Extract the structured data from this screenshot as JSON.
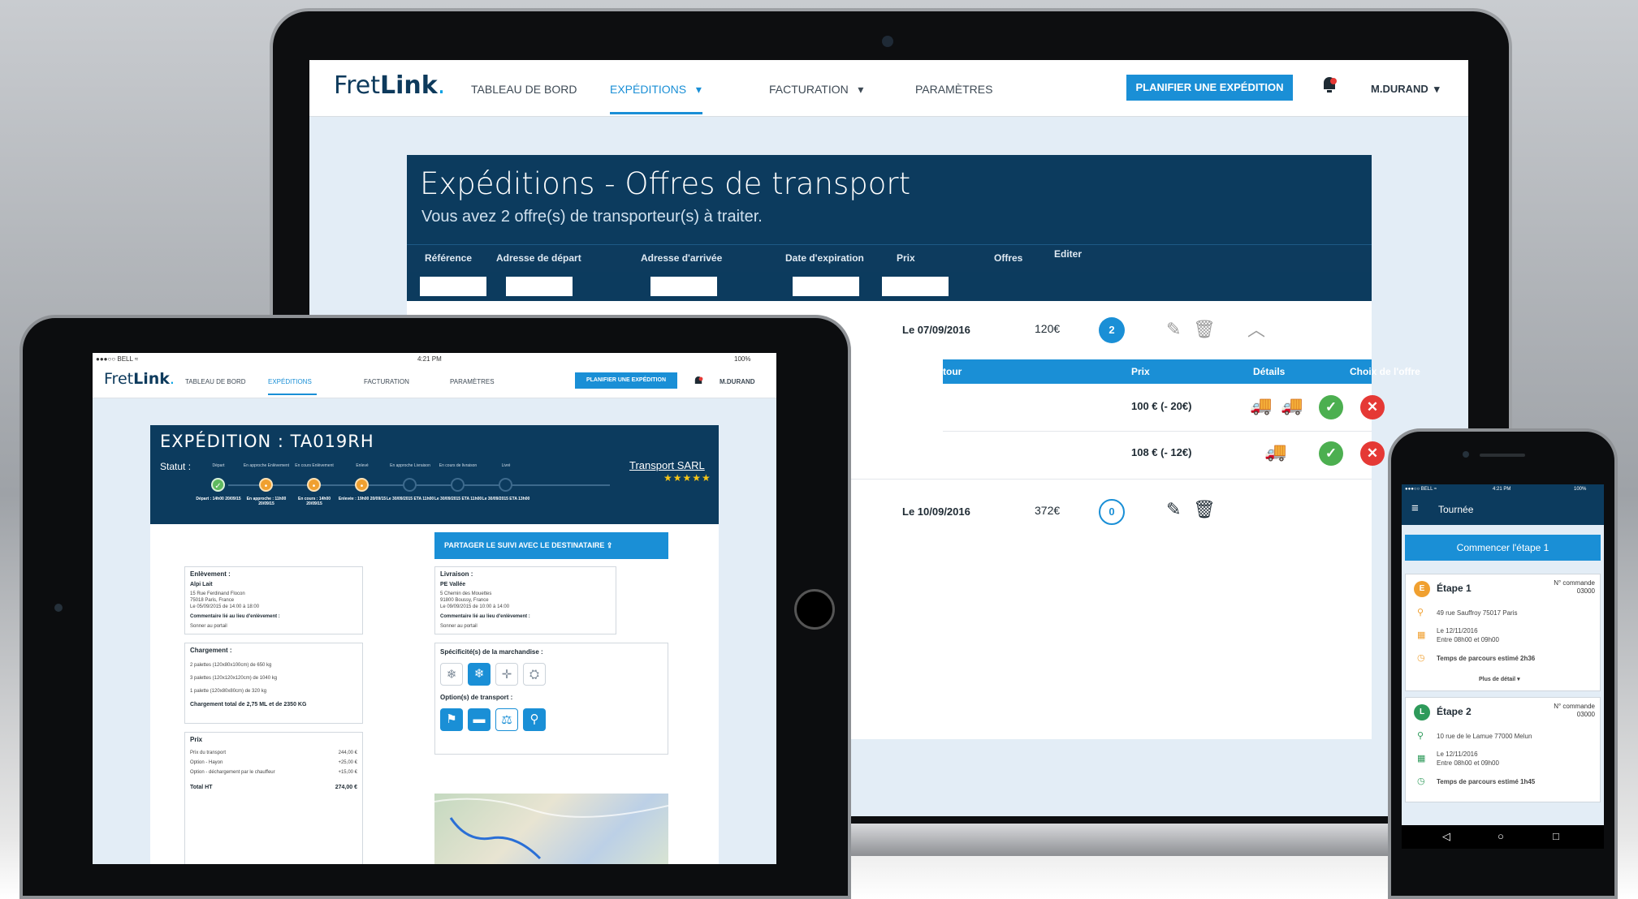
{
  "laptop": {
    "logo": {
      "fret": "Fret",
      "link": "Link",
      "dot": "."
    },
    "nav": [
      {
        "label": "TABLEAU DE BORD"
      },
      {
        "label": "EXPÉDITIONS"
      },
      {
        "label": "FACTURATION"
      },
      {
        "label": "PARAMÈTRES"
      }
    ],
    "dropdown_caret": "▾",
    "plan_button": "PLANIFIER UNE EXPÉDITION",
    "user": "M.DURAND",
    "title": "Expéditions - Offres de transport",
    "subtitle": "Vous avez 2 offre(s) de transporteur(s) à traiter.",
    "columns": [
      "Référence",
      "Adresse de départ",
      "Adresse d'arrivée",
      "Date d'expiration",
      "Prix",
      "Offres",
      "Editer"
    ],
    "offer_columns": [
      "tour",
      "Prix",
      "Détails",
      "Choix de l'offre"
    ],
    "rows": [
      {
        "date": "Le 07/09/2016",
        "price": "120€",
        "offers": "2"
      },
      {
        "date": "Le 10/09/2016",
        "price": "372€",
        "offers": "0"
      }
    ],
    "offers": [
      {
        "price": "100 € (- 20€)"
      },
      {
        "price": "108 € (- 12€)"
      }
    ]
  },
  "tablet": {
    "status": {
      "carrier": "●●●○○ BELL ≈",
      "time": "4:21 PM",
      "battery": "100%"
    },
    "logo": {
      "fret": "Fret",
      "link": "Link",
      "dot": "."
    },
    "nav": [
      {
        "label": "TABLEAU DE BORD"
      },
      {
        "label": "EXPÉDITIONS"
      },
      {
        "label": "FACTURATION"
      },
      {
        "label": "PARAMÈTRES"
      }
    ],
    "plan_button": "PLANIFIER UNE EXPÉDITION",
    "user": "M.DURAND",
    "title": "EXPÉDITION : TA019RH",
    "statut_label": "Statut :",
    "carrier": "Transport SARL",
    "stars": "★★★★★",
    "steps": [
      {
        "label": "Départ",
        "date": "Départ : 14h00 20/09/15",
        "state": "done"
      },
      {
        "label": "En approche Enlèvement",
        "date": "En approche : 11h00 20/09/15",
        "state": "active"
      },
      {
        "label": "En cours Enlèvement",
        "date": "En cours : 14h00 20/09/15",
        "state": "active"
      },
      {
        "label": "Enlevé",
        "date": "Enlevée : 19h00 20/09/15",
        "state": "active"
      },
      {
        "label": "En approche Livraison",
        "date": "Le 30/09/2015 ETA 11h00",
        "state": "pending"
      },
      {
        "label": "En cours de livraison",
        "date": "Le 30/09/2015 ETA 11h00",
        "state": "pending"
      },
      {
        "label": "Livré",
        "date": "Le 30/09/2015 ETA 13h00",
        "state": "pending"
      }
    ],
    "share_button": "PARTAGER LE SUIVI AVEC LE DESTINATAIRE",
    "pickup": {
      "title": "Enlèvement :",
      "name": "Alpi Lait",
      "address1": "15 Rue Ferdinand Flocon",
      "address2": "75018 Paris, France",
      "date": "Le 05/09/2015 de 14:00 à 18:00",
      "comment_label": "Commentaire lié au lieu d'enlèvement :",
      "comment": "Sonner au portail"
    },
    "delivery": {
      "title": "Livraison :",
      "name": "PE Vallée",
      "address1": "5 Chemin des Mouettes",
      "address2": "91800 Boussy, France",
      "date": "Le 09/09/2015 de 10:00 à 14:00",
      "comment_label": "Commentaire lié au lieu d'enlèvement :",
      "comment": "Sonner au portail"
    },
    "load": {
      "title": "Chargement :",
      "lines": [
        "2 palettes (120x80x100cm) de 650 kg",
        "3 palettes (120x120x120cm) de 1040 kg",
        "1 palette (120x80x80cm) de 320 kg"
      ],
      "total": "Chargement total de 2,75 ML et de 2350 KG"
    },
    "spec": {
      "title": "Spécificité(s) de la marchandise :",
      "options_title": "Option(s) de transport :"
    },
    "spec_icons": [
      "❄",
      "❄",
      "✛",
      "⛭"
    ],
    "option_icons": [
      "⚑",
      "▬",
      "⚖",
      "⚲"
    ],
    "pricing": {
      "title": "Prix",
      "lines": [
        {
          "label": "Prix du transport",
          "value": "244,00 €"
        },
        {
          "label": "Option - Hayon",
          "value": "+25,00 €"
        },
        {
          "label": "Option - déchargement par le chauffeur",
          "value": "+15,00 €"
        }
      ],
      "total_label": "Total HT",
      "total_value": "274,00 €"
    }
  },
  "phone": {
    "status": {
      "carrier": "●●●○○ BELL ≈",
      "time": "4:21 PM",
      "battery": "100%"
    },
    "title": "Tournée",
    "start_button": "Commencer l'étape 1",
    "order_label": "N° commande",
    "stops": [
      {
        "badge": "E",
        "title": "Étape 1",
        "order": "03000",
        "address": "49 rue Sauffroy 75017 Paris",
        "date": "Le 12/11/2016",
        "window": "Entre 08h00 et 09h00",
        "eta_label": "Temps de parcours estimé",
        "eta": "2h36",
        "more": "Plus de détail ▾",
        "color": "#f0a030"
      },
      {
        "badge": "L",
        "title": "Étape 2",
        "order": "03000",
        "address": "10 rue de le Lamue 77000 Melun",
        "date": "Le 12/11/2016",
        "window": "Entre 08h00 et 09h00",
        "eta_label": "Temps de parcours estimé",
        "eta": "1h45",
        "color": "#2e9a5a"
      }
    ],
    "nav": {
      "back": "◁",
      "home": "○",
      "recent": "□"
    }
  },
  "colors": {
    "brand_navy": "#0c3b5e",
    "accent_blue": "#1a8fd6",
    "ok_green": "#4caf50",
    "cancel_red": "#e53935",
    "warning_orange": "#f0a030"
  }
}
